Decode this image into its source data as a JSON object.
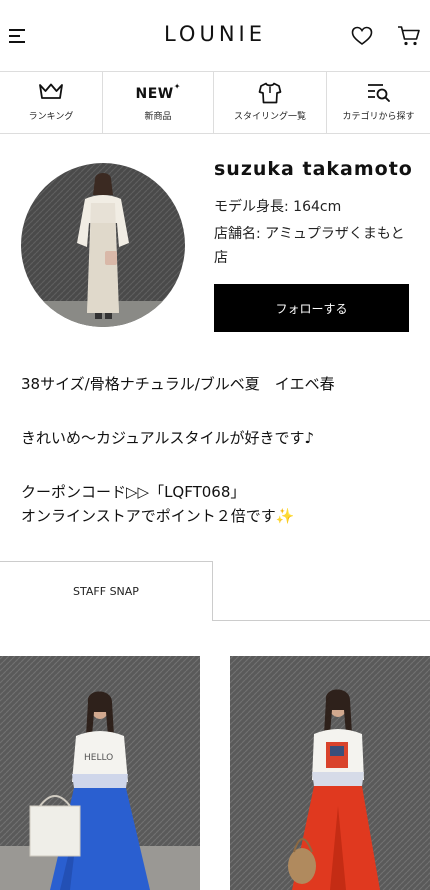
{
  "header": {
    "logo": "LOUNIE",
    "icons": [
      "menu-icon",
      "heart-icon",
      "cart-icon"
    ]
  },
  "nav": {
    "items": [
      {
        "label": "ランキング",
        "icon": "crown-icon"
      },
      {
        "label": "新商品",
        "icon_text": "NEW",
        "icon": "new-badge-icon"
      },
      {
        "label": "スタイリング一覧",
        "icon": "shirt-icon"
      },
      {
        "label": "カテゴリから探す",
        "icon": "category-search-icon"
      }
    ]
  },
  "profile": {
    "name": "suzuka takamoto",
    "height": "モデル身長:  164cm",
    "store": "店舗名:  アミュプラザくまもと店",
    "follow_label": "フォローする"
  },
  "bio": {
    "line1": "38サイズ/骨格ナチュラル/ブルベ夏　イエベ春",
    "line2": "きれいめ〜カジュアルスタイルが好きです♪",
    "line3": "クーポンコード▷▷「LQFT068」",
    "line4": "オンラインストアでポイント２倍です✨"
  },
  "tabs": {
    "active": "STAFF SNAP"
  },
  "snaps": [
    {
      "name": "snap-blue-skirt",
      "skirt_color": "#2a5fd0"
    },
    {
      "name": "snap-red-skirt",
      "skirt_color": "#e0391f"
    }
  ],
  "colors": {
    "text": "#111111",
    "border": "#dddddd",
    "button_bg": "#000000",
    "button_text": "#ffffff"
  }
}
